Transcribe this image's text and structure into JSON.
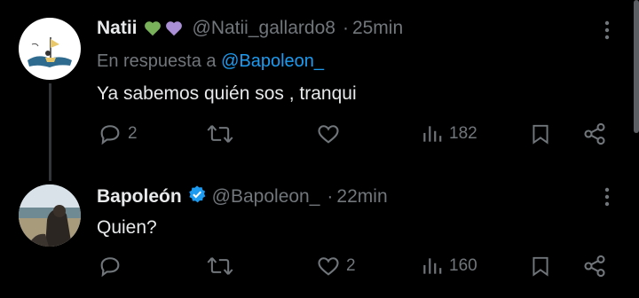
{
  "colors": {
    "background": "#000000",
    "text": "#e7e9ea",
    "muted": "#71767b",
    "link": "#1d9bf0",
    "verified": "#1d9bf0"
  },
  "tweets": [
    {
      "name": "Natii",
      "emoji": [
        "green-heart",
        "purple-heart"
      ],
      "handle": "@Natii_gallardo8",
      "separator": "·",
      "time": "25min",
      "reply_prefix": "En respuesta a",
      "reply_mention": "@Bapoleon_",
      "text": "Ya sabemos quién sos , tranqui",
      "stats": {
        "replies": "2",
        "retweets": "",
        "likes": "",
        "views": "182"
      }
    },
    {
      "name": "Bapoleón",
      "verified": true,
      "handle": "@Bapoleon_",
      "separator": "·",
      "time": "22min",
      "text": "Quien?",
      "stats": {
        "replies": "",
        "retweets": "",
        "likes": "2",
        "views": "160"
      }
    }
  ],
  "icons": [
    "reply-icon",
    "retweet-icon",
    "like-icon",
    "views-icon",
    "bookmark-icon",
    "share-icon",
    "more-icon"
  ]
}
